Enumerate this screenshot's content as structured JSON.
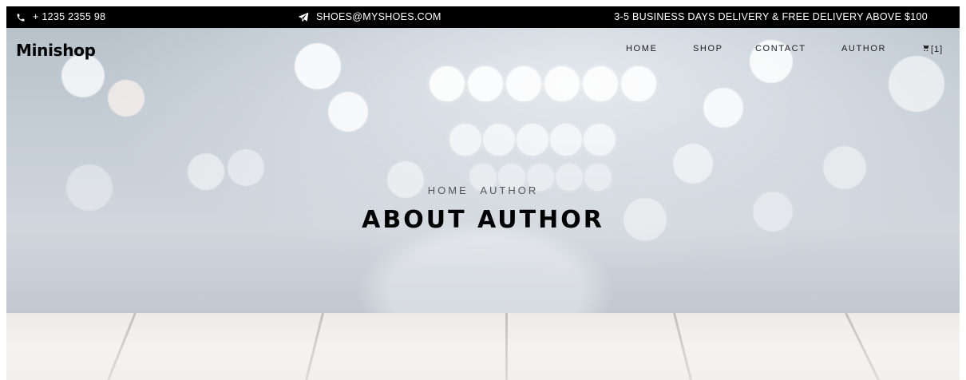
{
  "topbar": {
    "phone": "+ 1235 2355 98",
    "email": "SHOES@MYSHOES.COM",
    "delivery": "3-5 BUSINESS DAYS DELIVERY & FREE DELIVERY ABOVE $100"
  },
  "header": {
    "brand": "Minishop",
    "nav": [
      {
        "label": "HOME"
      },
      {
        "label": "SHOP"
      },
      {
        "label": "CONTACT"
      },
      {
        "label": "AUTHOR"
      }
    ],
    "cart_count": "[1]"
  },
  "hero": {
    "breadcrumb": [
      "HOME",
      "AUTHOR"
    ],
    "title": "ABOUT AUTHOR"
  },
  "icons": {
    "phone": "phone-icon",
    "email": "paper-plane-icon",
    "cart": "cart-icon"
  },
  "colors": {
    "topbar_bg": "#000000",
    "topbar_text": "#ffffff",
    "title": "#000000",
    "breadcrumb": "#555555"
  }
}
